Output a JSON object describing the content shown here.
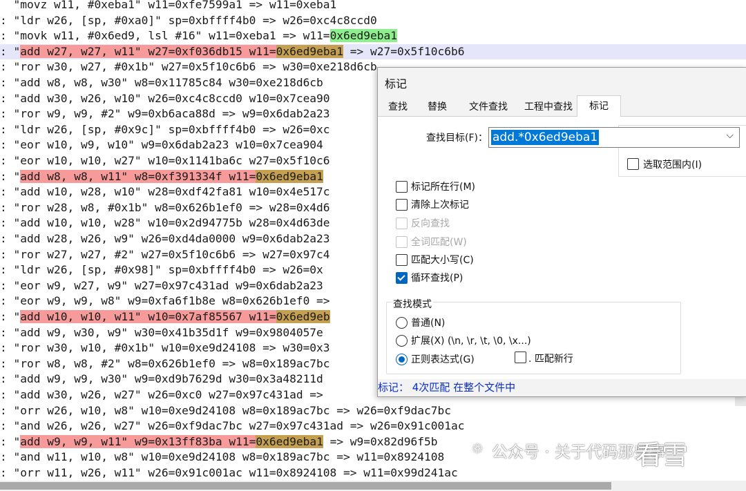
{
  "editor": {
    "lines": [
      {
        "prefix": "",
        "parts": [
          {
            "t": "  \"movz w11, #0xeba1\" w11=0xfe7599a1 => w11=0xeba1"
          }
        ]
      },
      {
        "prefix": ": ",
        "parts": [
          {
            "t": "\"ldr w26, [sp, #0xa0]\" sp=0xbffff4b0 => w26=0xc4c8ccd0"
          }
        ]
      },
      {
        "prefix": ": ",
        "parts": [
          {
            "t": "\"movk w11, #0x6ed9, lsl #16\" w11=0xeba1 => w11="
          },
          {
            "t": "0x6ed9eba1",
            "c": "green"
          }
        ]
      },
      {
        "prefix": ": ",
        "cur": true,
        "parts": [
          {
            "t": "\"",
            "c": ""
          },
          {
            "t": "add w27, w27, w11\" w27=0xf036db15 w11=",
            "c": "mark"
          },
          {
            "t": "0x6ed9eba1",
            "c": "hl"
          },
          {
            "t": " => w27=0x5f10c6b6"
          }
        ]
      },
      {
        "prefix": ": ",
        "parts": [
          {
            "t": "\"ror w30, w27, #0x1b\" w27=0x5f10c6b6 => w30=0xe218d6cb"
          }
        ]
      },
      {
        "prefix": ": ",
        "parts": [
          {
            "t": "\"add w8, w8, w30\" w8=0x11785c84 w30=0xe218d6cb"
          }
        ]
      },
      {
        "prefix": ": ",
        "parts": [
          {
            "t": "\"add w30, w26, w10\" w26=0xc4c8ccd0 w10=0x7cea90"
          }
        ]
      },
      {
        "prefix": ": ",
        "parts": [
          {
            "t": "\"ror w9, w9, #2\" w9=0xb6aca88d => w9=0x6dab2a23"
          }
        ]
      },
      {
        "prefix": ": ",
        "parts": [
          {
            "t": "\"ldr w26, [sp, #0x9c]\" sp=0xbffff4b0 => w26=0xc"
          }
        ]
      },
      {
        "prefix": ": ",
        "parts": [
          {
            "t": "\"eor w10, w9, w10\" w9=0x6dab2a23 w10=0x7cea904"
          }
        ]
      },
      {
        "prefix": ": ",
        "parts": [
          {
            "t": "\"eor w10, w10, w27\" w10=0x1141ba6c w27=0x5f10c6"
          }
        ]
      },
      {
        "prefix": ": ",
        "parts": [
          {
            "t": "\""
          },
          {
            "t": "add w8, w8, w11\" w8=0xf391334f w11=",
            "c": "mark"
          },
          {
            "t": "0x6ed9eba1",
            "c": "hl"
          }
        ]
      },
      {
        "prefix": ": ",
        "parts": [
          {
            "t": "\"add w10, w28, w10\" w28=0xdf42fa81 w10=0x4e517c"
          }
        ]
      },
      {
        "prefix": ": ",
        "parts": [
          {
            "t": "\"ror w28, w8, #0x1b\" w8=0x626b1ef0 => w28=0x4d6"
          }
        ]
      },
      {
        "prefix": ": ",
        "parts": [
          {
            "t": "\"add w10, w10, w28\" w10=0x2d94775b w28=0x4d63de"
          }
        ]
      },
      {
        "prefix": ": ",
        "parts": [
          {
            "t": "\"add w28, w26, w9\" w26=0xd4da0000 w9=0x6dab2a23"
          }
        ]
      },
      {
        "prefix": ": ",
        "parts": [
          {
            "t": "\"ror w27, w27, #2\" w27=0x5f10c6b6 => w27=0x97c4"
          }
        ]
      },
      {
        "prefix": ": ",
        "parts": [
          {
            "t": "\"ldr w26, [sp, #0x98]\" sp=0xbffff4b0 => w26=0x"
          }
        ]
      },
      {
        "prefix": ": ",
        "parts": [
          {
            "t": "\"eor w9, w27, w9\" w27=0x97c431ad w9=0x6dab2a23"
          }
        ]
      },
      {
        "prefix": ": ",
        "parts": [
          {
            "t": "\"eor w9, w9, w8\" w9=0xfa6f1b8e w8=0x626b1ef0 =>"
          }
        ]
      },
      {
        "prefix": ": ",
        "parts": [
          {
            "t": "\""
          },
          {
            "t": "add w10, w10, w11\" w10=0x7af85567 w11=",
            "c": "mark"
          },
          {
            "t": "0x6ed9eb",
            "c": "hl"
          }
        ]
      },
      {
        "prefix": ": ",
        "parts": [
          {
            "t": "\"add w9, w30, w9\" w30=0x41b35d1f w9=0x9804057e"
          }
        ]
      },
      {
        "prefix": ": ",
        "parts": [
          {
            "t": "\"ror w30, w10, #0x1b\" w10=0xe9d24108 => w30=0x3"
          }
        ]
      },
      {
        "prefix": ": ",
        "parts": [
          {
            "t": "\"ror w8, w8, #2\" w8=0x626b1ef0 => w8=0x189ac7bc"
          }
        ]
      },
      {
        "prefix": ": ",
        "parts": [
          {
            "t": "\"add w9, w9, w30\" w9=0xd9b7629d w30=0x3a48211d"
          }
        ]
      },
      {
        "prefix": ": ",
        "parts": [
          {
            "t": "\"add w30, w26, w27\" w26=0xc0 w27=0x97c431ad =>"
          }
        ]
      },
      {
        "prefix": ": ",
        "parts": [
          {
            "t": "\"orr w26, w10, w8\" w10=0xe9d24108 w8=0x189ac7bc => w26=0xf9dac7bc"
          }
        ]
      },
      {
        "prefix": ": ",
        "parts": [
          {
            "t": "\"and w26, w26, w27\" w26=0xf9dac7bc w27=0x97c431ad => w26=0x91c001ac"
          }
        ]
      },
      {
        "prefix": ": ",
        "parts": [
          {
            "t": "\""
          },
          {
            "t": "add w9, w9, w11\" w9=0x13ff83ba w11=",
            "c": "mark"
          },
          {
            "t": "0x6ed9eba1",
            "c": "hl"
          },
          {
            "t": " => w9=0x82d96f5b"
          }
        ]
      },
      {
        "prefix": ": ",
        "parts": [
          {
            "t": "\"and w11, w10, w8\" w10=0xe9d24108 w8=0x189ac7bc => w11=0x8924108"
          }
        ]
      },
      {
        "prefix": ": ",
        "parts": [
          {
            "t": "\"orr w11, w26, w11\" w26=0x91c001ac w11=0x8924108 => w11=0x99d241ac"
          }
        ]
      }
    ]
  },
  "dialog": {
    "title": "标记",
    "tabs": [
      "查找",
      "替换",
      "文件查找",
      "工程中查找",
      "标记"
    ],
    "find_target_label": "查找目标(F)：",
    "find_target_value": "add.*0x6ed9eba1",
    "in_selection_label": "选取范围内(I)",
    "options": [
      {
        "label": "标记所在行(M)",
        "checked": false,
        "disabled": false
      },
      {
        "label": "清除上次标记",
        "checked": false,
        "disabled": false
      },
      {
        "label": "反向查找",
        "checked": false,
        "disabled": true
      },
      {
        "label": "全词匹配(W)",
        "checked": false,
        "disabled": true
      },
      {
        "label": "匹配大小写(C)",
        "checked": false,
        "disabled": false
      },
      {
        "label": "循环查找(P)",
        "checked": true,
        "disabled": false
      }
    ],
    "search_mode_title": "查找模式",
    "modes": [
      {
        "label": "普通(N)",
        "checked": false
      },
      {
        "label": "扩展(X) (\\n, \\r, \\t, \\0, \\x...)",
        "checked": false
      },
      {
        "label": "正则表达式(G)",
        "checked": true
      }
    ],
    "match_newline_label": ". 匹配新行",
    "status": "标记：  4次匹配 在整个文件中"
  },
  "watermark": {
    "text": "公众号 · 关于代码那些事",
    "brand": "看雪"
  },
  "colors": {
    "mark": "#f79a9a",
    "match": "#c4a050",
    "green": "#8df08d",
    "accent": "#0067c0",
    "status": "#0a2ec7"
  }
}
